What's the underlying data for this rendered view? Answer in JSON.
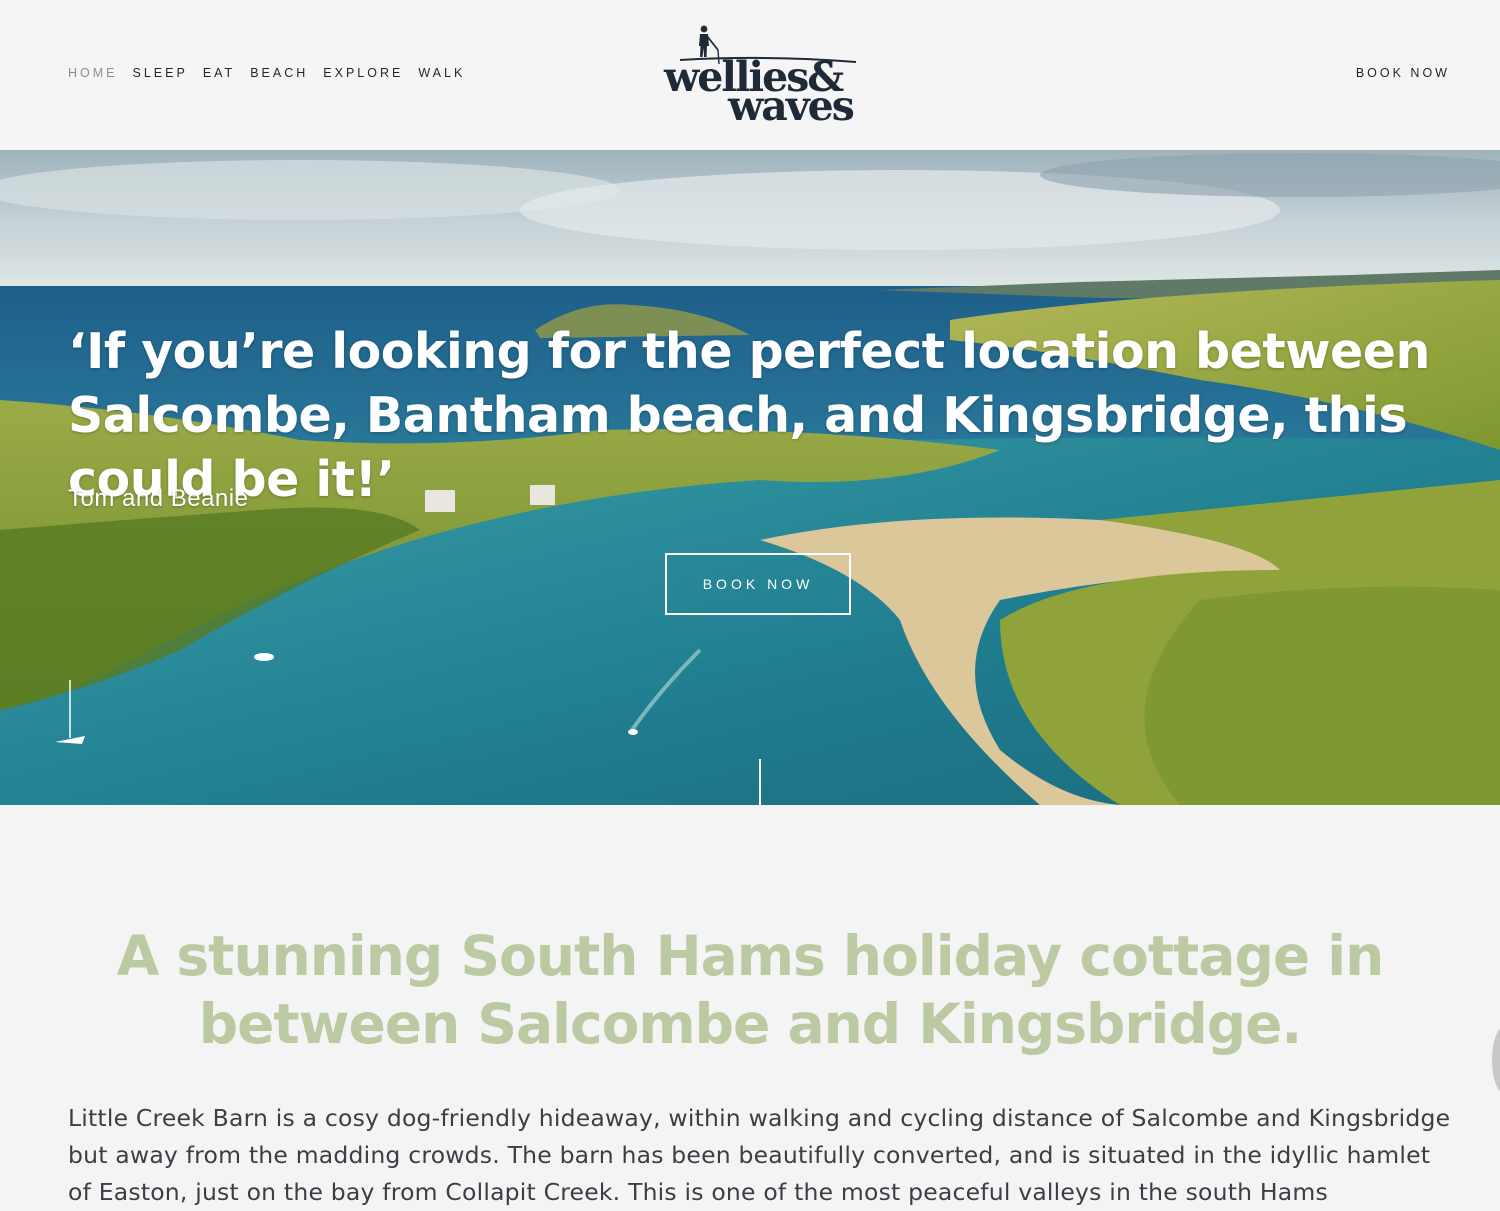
{
  "nav": {
    "items": [
      {
        "label": "HOME",
        "active": true
      },
      {
        "label": "SLEEP"
      },
      {
        "label": "EAT"
      },
      {
        "label": "BEACH"
      },
      {
        "label": "EXPLORE"
      },
      {
        "label": "WALK"
      }
    ],
    "book_label": "BOOK NOW"
  },
  "logo": {
    "line1": "wellies&",
    "line2": "waves"
  },
  "hero": {
    "quote": "‘If you’re looking for the perfect location between Salcombe, Bantham beach, and Kingsbridge, this could be it!’",
    "author": "Tom and Beanie",
    "button_label": "BOOK NOW"
  },
  "intro": {
    "title": "A stunning South Hams holiday cottage in between Salcombe and Kingsbridge.",
    "body": "Little Creek Barn is a cosy dog-friendly hideaway, within walking and cycling distance of Salcombe and Kingsbridge but away from the madding crowds. The barn has been beautifully converted, and is situated in the idyllic hamlet of Easton, just on the bay from Collapit Creek. This is one of the most peaceful valleys in the south Hams"
  },
  "colors": {
    "accent_green": "#bccaa3",
    "navy": "#1f2a38",
    "background": "#f4f4f4"
  }
}
